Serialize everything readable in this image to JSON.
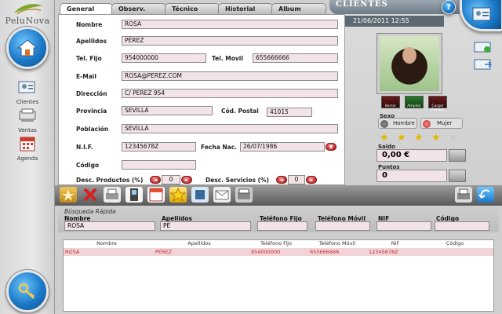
{
  "app": {
    "brand": "PeluNova",
    "window_title": "CLIENTES",
    "datetime": "21/06/2011   12:55"
  },
  "tabs": [
    {
      "label": "General",
      "active": true
    },
    {
      "label": "Observ."
    },
    {
      "label": "Técnico"
    },
    {
      "label": "Historial"
    },
    {
      "label": "Album"
    }
  ],
  "sidebar": {
    "items": [
      {
        "label": "Clientes",
        "icon": "clients-icon"
      },
      {
        "label": "Ventas",
        "icon": "sales-icon"
      },
      {
        "label": "Agenda",
        "icon": "calendar-icon"
      }
    ]
  },
  "form": {
    "nombre": {
      "label": "Nombre",
      "value": "ROSA"
    },
    "apellidos": {
      "label": "Apellidos",
      "value": "PÉREZ"
    },
    "tel_fijo": {
      "label": "Tel. Fijo",
      "value": "954000000"
    },
    "tel_movil": {
      "label": "Tel. Movil",
      "value": "655666666"
    },
    "email": {
      "label": "E-Mail",
      "value": "ROSA@PEREZ.COM"
    },
    "direccion": {
      "label": "Dirección",
      "value": "C/ PEREZ 954"
    },
    "provincia": {
      "label": "Provincia",
      "value": "SEVILLA"
    },
    "cod_postal": {
      "label": "Cód. Postal",
      "value": "41015"
    },
    "poblacion": {
      "label": "Población",
      "value": "SEVILLA"
    },
    "nif": {
      "label": "N.I.F.",
      "value": "12345678Z"
    },
    "fecha_nac": {
      "label": "Fecha Nac.",
      "value": "26/07/1986"
    },
    "codigo": {
      "label": "Código",
      "value": ""
    },
    "desc_productos": {
      "label": "Desc. Productos (%)",
      "value": "0"
    },
    "desc_servicios": {
      "label": "Desc. Servicios (%)",
      "value": "0"
    }
  },
  "profile": {
    "photo_buttons": [
      "Borrar",
      "Ampliar",
      "Cargar Fichero"
    ],
    "sexo_label": "Sexo",
    "sexo_options": [
      "Hombre",
      "Mujer"
    ],
    "rating": 4,
    "rating_max": 5,
    "saldo_label": "Saldo",
    "saldo_value": "0,00 €",
    "puntos_label": "Puntos",
    "puntos_value": "0"
  },
  "quick_search": {
    "title": "Búsqueda Rápida",
    "fields": [
      {
        "label": "Nombre",
        "value": "ROSA"
      },
      {
        "label": "Apellidos",
        "value": "PÉ"
      },
      {
        "label": "Teléfono Fijo",
        "value": ""
      },
      {
        "label": "Teléfono Móvil",
        "value": ""
      },
      {
        "label": "NIF",
        "value": ""
      },
      {
        "label": "Código",
        "value": ""
      }
    ]
  },
  "results": {
    "columns": [
      "Nombre",
      "Apellidos",
      "Teléfono Fijo",
      "Teléfono Móvil",
      "NIF",
      "Código"
    ],
    "rows": [
      [
        "ROSA",
        "PÉREZ",
        "954000000",
        "655666666",
        "12345678Z",
        ""
      ]
    ]
  },
  "colors": {
    "accent_blue": "#1b79c7",
    "field_pink": "#f2e3e6",
    "selected_row": "#f2d4d8",
    "selected_text": "#c0282a"
  }
}
